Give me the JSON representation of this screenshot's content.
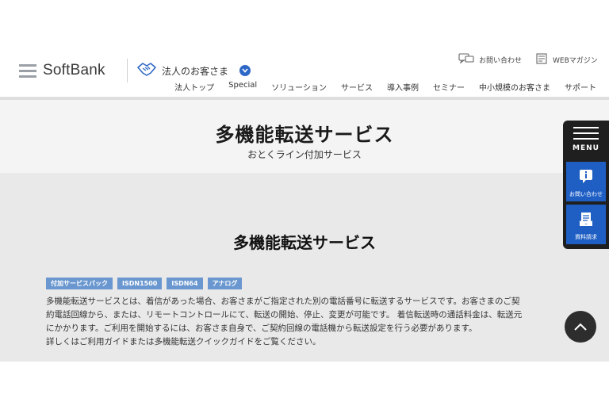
{
  "header": {
    "logo_text": "SoftBank",
    "biz_label": "法人のお客さま",
    "utility": {
      "contact_label": "お問い合わせ",
      "webmag_label": "WEBマガジン"
    },
    "nav": [
      {
        "label": "法人トップ"
      },
      {
        "label": "Special"
      },
      {
        "label": "ソリューション"
      },
      {
        "label": "サービス"
      },
      {
        "label": "導入事例"
      },
      {
        "label": "セミナー"
      },
      {
        "label": "中小規模のお客さま"
      },
      {
        "label": "サポート"
      }
    ]
  },
  "title_band": {
    "title": "多機能転送サービス",
    "subtitle": "おとくライン付加サービス"
  },
  "main": {
    "section_title": "多機能転送サービス",
    "tags": [
      "付加サービスパック",
      "ISDN1500",
      "ISDN64",
      "アナログ"
    ],
    "description": [
      "多機能転送サービスとは、着信があった場合、お客さまがご指定された別の電話番号に転送するサービスです。お客さまのご契",
      "約電話回線から、または、リモートコントロールにて、転送の開始、停止、変更が可能です。 着信転送時の通話料金は、転送元",
      "にかかります。ご利用を開始するには、お客さま自身で、ご契約回線の電話機から転送設定を行う必要があります。",
      "詳しくはご利用ガイドまたは多機能転送クイックガイドをご覧ください。"
    ]
  },
  "side_panel": {
    "menu_label": "MENU",
    "contact_label": "お問い合わせ",
    "docs_label": "資料請求"
  },
  "colors": {
    "accent_blue": "#1f5fc4",
    "tag_blue": "#6a97cf",
    "panel_dark": "#1f1f1f"
  },
  "icons": [
    "softbank-logo-bars",
    "handshake-icon",
    "chevron-down-icon",
    "chat-icon",
    "magazine-icon",
    "menu-icon",
    "info-icon",
    "document-icon",
    "arrow-up-icon"
  ]
}
